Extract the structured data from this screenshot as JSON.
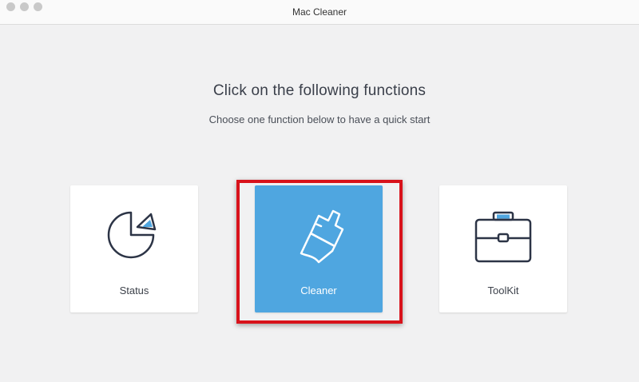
{
  "window": {
    "title": "Mac Cleaner"
  },
  "main": {
    "headline": "Click on the following functions",
    "subtitle": "Choose one function below to have a quick start"
  },
  "functions": [
    {
      "label": "Status",
      "icon": "pie-chart-icon"
    },
    {
      "label": "Cleaner",
      "icon": "brush-icon",
      "selected": true
    },
    {
      "label": "ToolKit",
      "icon": "toolbox-icon"
    }
  ],
  "colors": {
    "accent": "#4fa6e0",
    "highlight_border": "#d8121b",
    "icon_stroke": "#2c3446",
    "background": "#f1f1f2"
  }
}
